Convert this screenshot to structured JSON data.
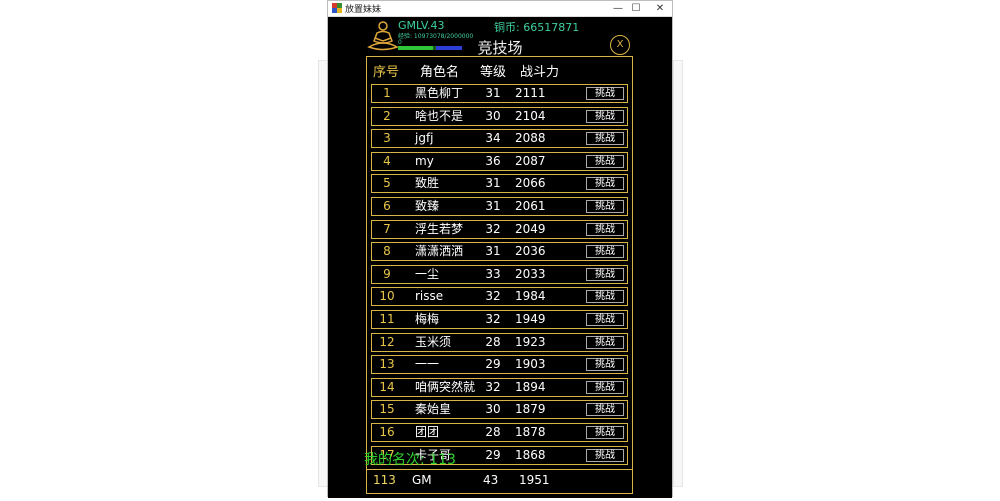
{
  "window": {
    "title": "放置妹妹",
    "minimize_glyph": "—",
    "maximize_glyph": "☐",
    "close_glyph": "✕"
  },
  "player": {
    "name_level": "GMLV.43",
    "coins": "铜币: 66517871",
    "exp": "经验: 10973078/2000000",
    "zero": "0",
    "hp_fraction": 0.55,
    "mp_fraction": 0.4
  },
  "arena": {
    "title": "竞技场",
    "close_label": "X",
    "headers": {
      "rank": "序号",
      "name": "角色名",
      "level": "等级",
      "power": "战斗力"
    },
    "challenge_label": "挑战",
    "rows": [
      {
        "rank": "1",
        "name": "黑色柳丁",
        "level": "31",
        "power": "2111"
      },
      {
        "rank": "2",
        "name": "啥也不是",
        "level": "30",
        "power": "2104"
      },
      {
        "rank": "3",
        "name": "jgfj",
        "level": "34",
        "power": "2088"
      },
      {
        "rank": "4",
        "name": "my",
        "level": "36",
        "power": "2087"
      },
      {
        "rank": "5",
        "name": "致胜",
        "level": "31",
        "power": "2066"
      },
      {
        "rank": "6",
        "name": "致臻",
        "level": "31",
        "power": "2061"
      },
      {
        "rank": "7",
        "name": "浮生若梦",
        "level": "32",
        "power": "2049"
      },
      {
        "rank": "8",
        "name": "潇潇洒洒",
        "level": "31",
        "power": "2036"
      },
      {
        "rank": "9",
        "name": "一尘",
        "level": "33",
        "power": "2033"
      },
      {
        "rank": "10",
        "name": "risse",
        "level": "32",
        "power": "1984"
      },
      {
        "rank": "11",
        "name": "梅梅",
        "level": "32",
        "power": "1949"
      },
      {
        "rank": "12",
        "name": "玉米须",
        "level": "28",
        "power": "1923"
      },
      {
        "rank": "13",
        "name": "一一",
        "level": "29",
        "power": "1903"
      },
      {
        "rank": "14",
        "name": "咱俩突然就",
        "level": "32",
        "power": "1894"
      },
      {
        "rank": "15",
        "name": "秦始皇",
        "level": "30",
        "power": "1879"
      },
      {
        "rank": "16",
        "name": "团团",
        "level": "28",
        "power": "1878"
      },
      {
        "rank": "17",
        "name": "卡子哥",
        "level": "29",
        "power": "1868"
      }
    ],
    "my_rank_label": "我的名次: 113",
    "my_row": {
      "rank": "113",
      "name": "GM",
      "level": "43",
      "power": "1951"
    }
  },
  "colors": {
    "gold": "#d8b645",
    "green": "#2fd12f",
    "teal": "#3fd0a0"
  }
}
